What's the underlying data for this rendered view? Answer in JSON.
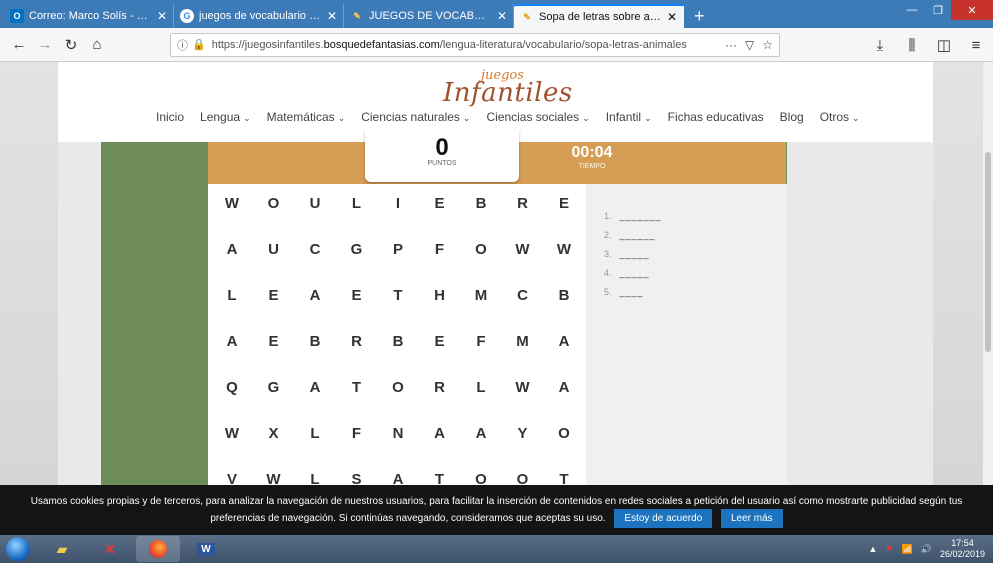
{
  "browser": {
    "tabs": [
      {
        "icon": "outlook-icon",
        "label": "Correo: Marco Solís - Outlook",
        "active": false
      },
      {
        "icon": "google-icon",
        "label": "juegos de vocabulario - Buscar",
        "active": false
      },
      {
        "icon": "pencil-icon",
        "label": "JUEGOS DE VOCABULARIO PAR",
        "active": false
      },
      {
        "icon": "pencil-icon",
        "label": "Sopa de letras sobre animales",
        "active": true
      }
    ],
    "new_tab": "+",
    "url_host_prefix": "https://juegosinfantiles.",
    "url_host": "bosquedefantasias.com",
    "url_path": "/lengua-literatura/vocabulario/sopa-letras-animales"
  },
  "site": {
    "logo_small": "juegos",
    "logo_big": "Infantiles",
    "menu": [
      {
        "label": "Inicio",
        "has_dropdown": false
      },
      {
        "label": "Lengua",
        "has_dropdown": true
      },
      {
        "label": "Matemáticas",
        "has_dropdown": true
      },
      {
        "label": "Ciencias naturales",
        "has_dropdown": true
      },
      {
        "label": "Ciencias sociales",
        "has_dropdown": true
      },
      {
        "label": "Infantil",
        "has_dropdown": true
      },
      {
        "label": "Fichas educativas",
        "has_dropdown": false
      },
      {
        "label": "Blog",
        "has_dropdown": false
      },
      {
        "label": "Otros",
        "has_dropdown": true
      }
    ]
  },
  "game": {
    "score": "0",
    "score_label": "PUNTOS",
    "time": "00:04",
    "time_label": "TIEMPO",
    "grid": [
      [
        "W",
        "O",
        "U",
        "L",
        "I",
        "E",
        "B",
        "R",
        "E"
      ],
      [
        "A",
        "U",
        "C",
        "G",
        "P",
        "F",
        "O",
        "W",
        "W"
      ],
      [
        "L",
        "E",
        "A",
        "E",
        "T",
        "H",
        "M",
        "C",
        "B"
      ],
      [
        "A",
        "E",
        "B",
        "R",
        "B",
        "E",
        "F",
        "M",
        "A"
      ],
      [
        "Q",
        "G",
        "A",
        "T",
        "O",
        "R",
        "L",
        "W",
        "A"
      ],
      [
        "W",
        "X",
        "L",
        "F",
        "N",
        "A",
        "A",
        "Y",
        "O"
      ],
      [
        "V",
        "W",
        "L",
        "S",
        "A",
        "T",
        "O",
        "O",
        "T"
      ]
    ],
    "answers": [
      {
        "num": "1.",
        "blank": "_______"
      },
      {
        "num": "2.",
        "blank": "______"
      },
      {
        "num": "3.",
        "blank": "_____"
      },
      {
        "num": "4.",
        "blank": "_____"
      },
      {
        "num": "5.",
        "blank": "____"
      }
    ]
  },
  "cookie": {
    "text_line1": "Usamos cookies propias y de terceros, para analizar la navegación de nuestros usuarios, para facilitar la inserción de contenidos en redes sociales a petición del usuario así como mostrarte publicidad según tus",
    "text_line2": "preferencias de navegación. Si continúas navegando, consideramos que aceptas su uso.",
    "accept_label": "Estoy de acuerdo",
    "more_label": "Leer más"
  },
  "taskbar": {
    "time": "17:54",
    "date": "26/02/2019"
  },
  "colors": {
    "tabbar": "#3d7ab8",
    "score_bar": "#d69d54",
    "green_panel": "#6e8c58",
    "cookie_btn": "#1e73be"
  }
}
